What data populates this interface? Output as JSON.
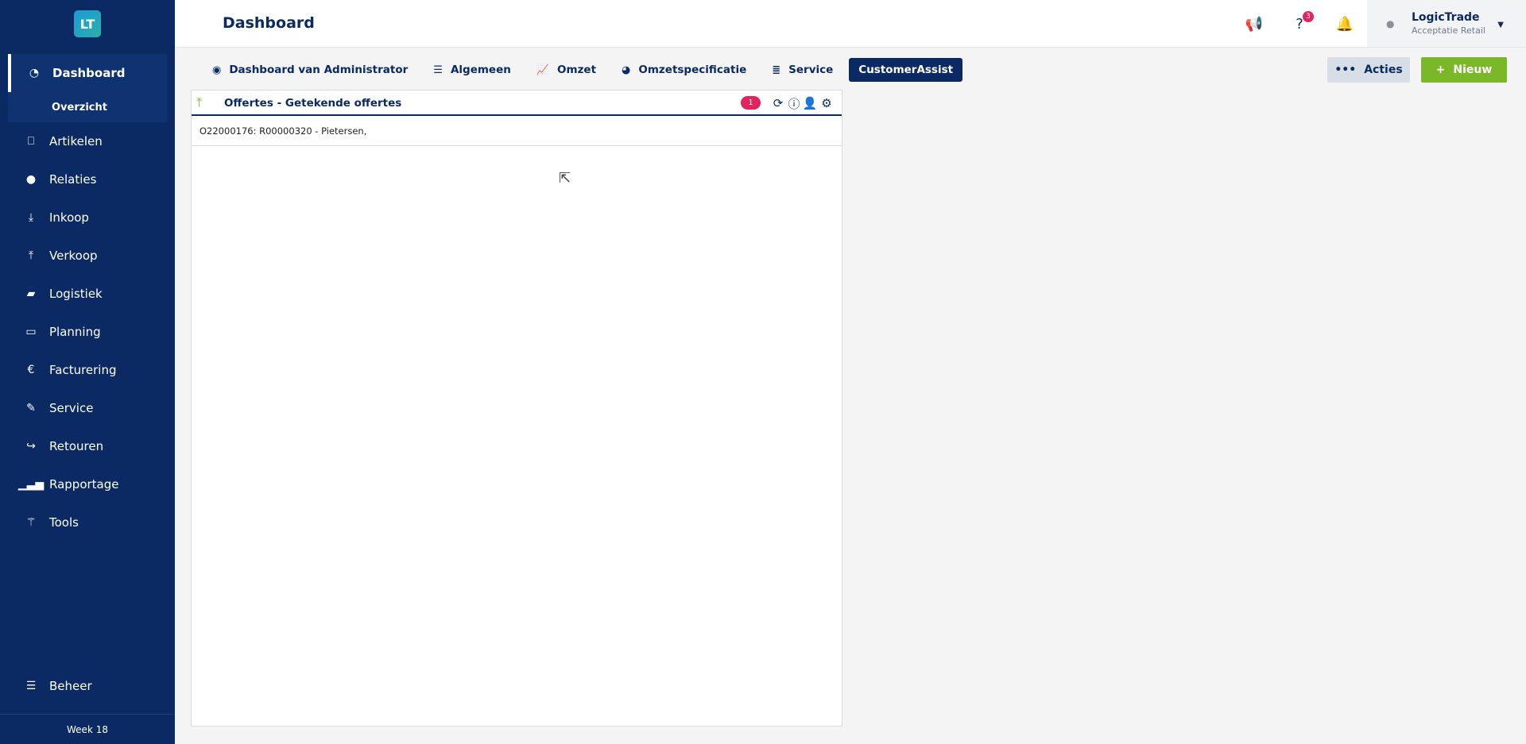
{
  "sidebar": {
    "logo": "LT",
    "items": [
      {
        "label": "Dashboard",
        "icon": "dashboard-gauge-icon"
      },
      {
        "label": "Artikelen",
        "icon": "inbox-icon"
      },
      {
        "label": "Relaties",
        "icon": "person-icon"
      },
      {
        "label": "Inkoop",
        "icon": "download-icon"
      },
      {
        "label": "Verkoop",
        "icon": "upload-icon"
      },
      {
        "label": "Logistiek",
        "icon": "truck-icon"
      },
      {
        "label": "Planning",
        "icon": "calendar-icon"
      },
      {
        "label": "Facturering",
        "icon": "euro-icon"
      },
      {
        "label": "Service",
        "icon": "wrench-icon"
      },
      {
        "label": "Retouren",
        "icon": "share-arrow-icon"
      },
      {
        "label": "Rapportage",
        "icon": "bar-signal-icon"
      },
      {
        "label": "Tools",
        "icon": "magic-wand-icon"
      }
    ],
    "sub_item": "Overzicht",
    "beheer": "Beheer",
    "week": "Week 18"
  },
  "header": {
    "title": "Dashboard",
    "help_badge": "3",
    "user_name": "LogicTrade",
    "user_sub": "Acceptatie Retail"
  },
  "tabs": [
    {
      "label": "Dashboard van Administrator",
      "icon": "user-circle-icon"
    },
    {
      "label": "Algemeen",
      "icon": "list-icon"
    },
    {
      "label": "Omzet",
      "icon": "line-chart-icon"
    },
    {
      "label": "Omzetspecificatie",
      "icon": "pie-chart-icon"
    },
    {
      "label": "Service",
      "icon": "server-icon"
    },
    {
      "label": "CustomerAssist",
      "icon": ""
    }
  ],
  "actions": {
    "acties": "Acties",
    "nieuw": "Nieuw"
  },
  "widget": {
    "title": "Offertes - Getekende offertes",
    "count": "1",
    "rows": [
      "O22000176: R00000320 - Pietersen,"
    ]
  },
  "colors": {
    "navy": "#0b2a63",
    "green": "#7ab829",
    "badge": "#e0245e"
  }
}
